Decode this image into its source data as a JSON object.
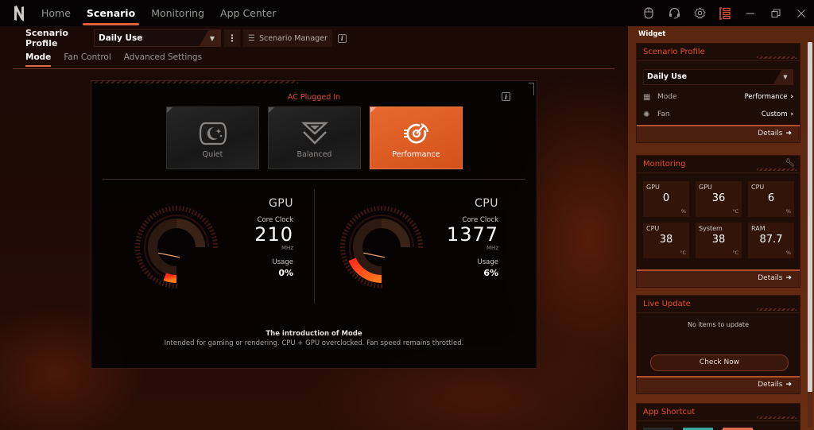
{
  "nav": {
    "items": [
      {
        "label": "Home",
        "active": false
      },
      {
        "label": "Scenario",
        "active": true
      },
      {
        "label": "Monitoring",
        "active": false
      },
      {
        "label": "App Center",
        "active": false
      }
    ],
    "icons": [
      "mouse-icon",
      "headset-icon",
      "gear-icon",
      "widget-panel-icon",
      "minimize-icon",
      "restore-icon",
      "close-icon"
    ]
  },
  "profile": {
    "label": "Scenario Profile",
    "selected": "Daily Use",
    "manager_label": "Scenario Manager"
  },
  "subtabs": [
    {
      "label": "Mode",
      "active": true
    },
    {
      "label": "Fan Control",
      "active": false
    },
    {
      "label": "Advanced Settings",
      "active": false
    }
  ],
  "panel": {
    "power_state": "AC Plugged In",
    "modes": [
      {
        "label": "Quiet",
        "active": false
      },
      {
        "label": "Balanced",
        "active": false
      },
      {
        "label": "Performance",
        "active": true
      }
    ],
    "gpu": {
      "title": "GPU",
      "core_clock_label": "Core Clock",
      "core_clock": "210",
      "unit": "MHz",
      "usage_label": "Usage",
      "usage": "0%",
      "usage_fraction": 0.0
    },
    "cpu": {
      "title": "CPU",
      "core_clock_label": "Core Clock",
      "core_clock": "1377",
      "unit": "MHz",
      "usage_label": "Usage",
      "usage": "6%",
      "usage_fraction": 0.06
    },
    "intro_title": "The introduction of Mode",
    "intro_desc": "Intended for gaming or rendering. CPU + GPU overclocked. Fan speed remains throttled."
  },
  "colors": {
    "accent": "#e0603a",
    "mode_active": "#e0622a",
    "alert_red": "#e04a30"
  },
  "widget": {
    "title": "Widget",
    "scenario_profile": {
      "title": "Scenario Profile",
      "selected": "Daily Use",
      "rows": [
        {
          "label": "Mode",
          "value": "Performance"
        },
        {
          "label": "Fan",
          "value": "Custom"
        }
      ],
      "details": "Details"
    },
    "monitoring": {
      "title": "Monitoring",
      "tiles": [
        {
          "label": "GPU",
          "value": "0",
          "unit": "%"
        },
        {
          "label": "GPU",
          "value": "36",
          "unit": "°C"
        },
        {
          "label": "CPU",
          "value": "6",
          "unit": "%"
        },
        {
          "label": "CPU",
          "value": "38",
          "unit": "°C"
        },
        {
          "label": "System",
          "value": "38",
          "unit": "°C"
        },
        {
          "label": "RAM",
          "value": "87.7",
          "unit": "%"
        }
      ],
      "details": "Details"
    },
    "live_update": {
      "title": "Live Update",
      "message": "No items to update",
      "button": "Check Now",
      "details": "Details"
    },
    "app_shortcut": {
      "title": "App Shortcut",
      "tile_colors": [
        "#2a2a2a",
        "#3aa898",
        "#e06a50"
      ]
    }
  }
}
